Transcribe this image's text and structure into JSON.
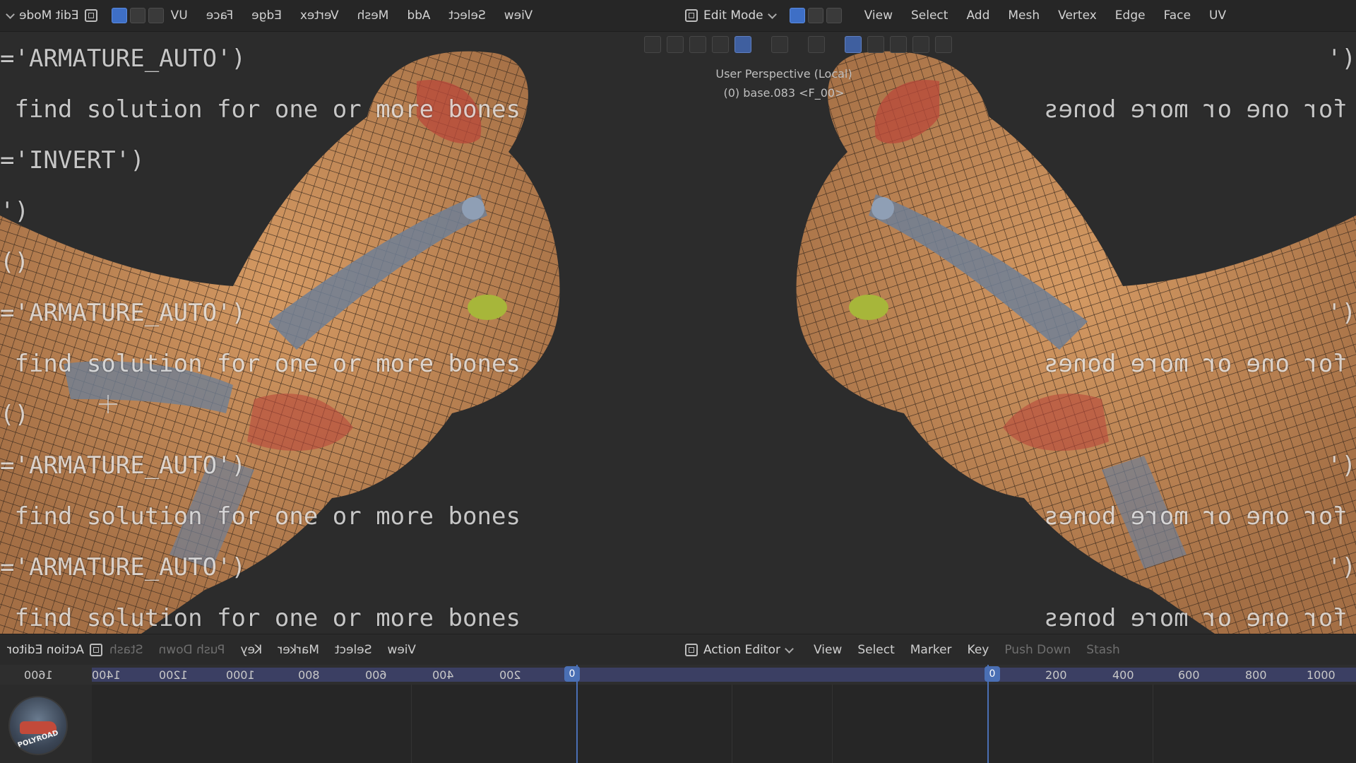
{
  "menubar": {
    "mode_label": "Edit Mode",
    "items": [
      "View",
      "Select",
      "Add",
      "Mesh",
      "Vertex",
      "Edge",
      "Face",
      "UV"
    ]
  },
  "viewport": {
    "perspective": "User Perspective (Local)",
    "object_info": "(0) base.083 <F_00>",
    "console_left": [
      "='ARMATURE_AUTO')",
      " find solution for one or more bones",
      "='INVERT')",
      "')",
      "()",
      "='ARMATURE_AUTO')",
      " find solution for one or more bones",
      "()",
      "='ARMATURE_AUTO')",
      " find solution for one or more bones",
      "='ARMATURE_AUTO')",
      " find solution for one or more bones"
    ],
    "console_right_mirrored": [
      "('",
      "for one or more bones",
      "('",
      "for one or more bones",
      "('",
      "for one or more bones",
      "('",
      "for one or more bones"
    ]
  },
  "timeline": {
    "editor_label": "Action Editor",
    "items": [
      "View",
      "Select",
      "Marker",
      "Key"
    ],
    "push_down": "Push Down",
    "stash": "Stash",
    "ruler_right": [
      "0",
      "200",
      "400",
      "600",
      "800",
      "1000"
    ],
    "ruler_left": [
      "1600",
      "1400",
      "1200",
      "1000",
      "800",
      "600",
      "400",
      "200",
      "0"
    ]
  },
  "watermark": {
    "label": "POLYROAD"
  },
  "colors": {
    "accent_blue": "#3e6fc6",
    "mesh_orange": "#c98a56",
    "mesh_red": "#b9483a",
    "mesh_blue": "#6f7f95"
  }
}
